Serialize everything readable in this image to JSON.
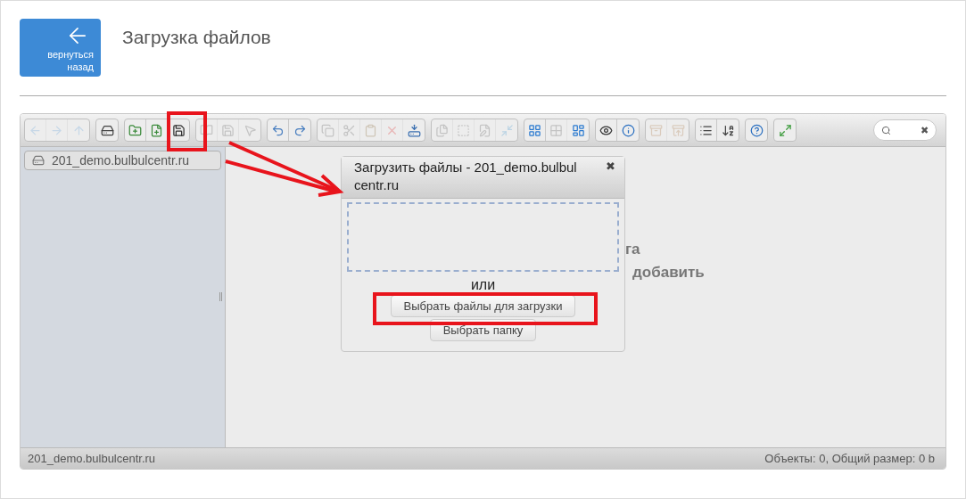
{
  "header": {
    "back_button": {
      "label_line_1": "вернуться",
      "label_line_2": "назад"
    },
    "title": "Загрузка файлов"
  },
  "toolbar": {
    "groups": [
      {
        "buttons": [
          {
            "kind": "back",
            "disabled": true
          },
          {
            "kind": "forward",
            "disabled": true
          },
          {
            "kind": "up",
            "disabled": true
          }
        ]
      },
      {
        "buttons": [
          {
            "kind": "drive",
            "disabled": false
          }
        ]
      },
      {
        "buttons": [
          {
            "kind": "new-folder",
            "disabled": false
          },
          {
            "kind": "new-file",
            "disabled": false
          },
          {
            "kind": "upload",
            "disabled": false
          }
        ]
      },
      {
        "buttons": [
          {
            "kind": "open",
            "disabled": true
          },
          {
            "kind": "save",
            "disabled": true
          },
          {
            "kind": "pointer",
            "disabled": true
          }
        ]
      },
      {
        "buttons": [
          {
            "kind": "undo",
            "disabled": false
          },
          {
            "kind": "redo",
            "disabled": false
          }
        ]
      },
      {
        "buttons": [
          {
            "kind": "copy",
            "disabled": true
          },
          {
            "kind": "cut",
            "disabled": true
          },
          {
            "kind": "paste",
            "disabled": true
          },
          {
            "kind": "delete",
            "disabled": true
          },
          {
            "kind": "remove",
            "disabled": false
          }
        ]
      },
      {
        "buttons": [
          {
            "kind": "duplicate",
            "disabled": true
          },
          {
            "kind": "rename",
            "disabled": true
          },
          {
            "kind": "edit",
            "disabled": true
          },
          {
            "kind": "resize",
            "disabled": true
          }
        ]
      },
      {
        "buttons": [
          {
            "kind": "icons-view",
            "disabled": false
          },
          {
            "kind": "small-icons",
            "disabled": true
          },
          {
            "kind": "list-view",
            "disabled": false
          }
        ]
      },
      {
        "buttons": [
          {
            "kind": "preview",
            "disabled": false
          },
          {
            "kind": "info",
            "disabled": false
          }
        ]
      },
      {
        "buttons": [
          {
            "kind": "archive",
            "disabled": true
          },
          {
            "kind": "extract",
            "disabled": true
          }
        ]
      },
      {
        "buttons": [
          {
            "kind": "list",
            "disabled": false
          },
          {
            "kind": "sort",
            "disabled": false
          }
        ]
      },
      {
        "buttons": [
          {
            "kind": "help",
            "disabled": false
          }
        ]
      },
      {
        "buttons": [
          {
            "kind": "fullscreen",
            "disabled": false
          }
        ]
      }
    ],
    "search": {
      "clear": "✖"
    }
  },
  "sidebar": {
    "items": [
      {
        "label": "201_demo.bulbulcentr.ru",
        "selected": true
      }
    ]
  },
  "workspace": {
    "hint_lines": [
      "га",
      "добавить"
    ]
  },
  "dialog": {
    "title": "Загрузить файлы - 201_demo.bulbulcentr.ru",
    "close": "✖",
    "or": "или",
    "buttons": [
      "Выбрать файлы для загрузки",
      "Выбрать папку"
    ]
  },
  "status_bar": {
    "path": "201_demo.bulbulcentr.ru",
    "summary": "Объекты: 0, Общий размер: 0 b"
  }
}
